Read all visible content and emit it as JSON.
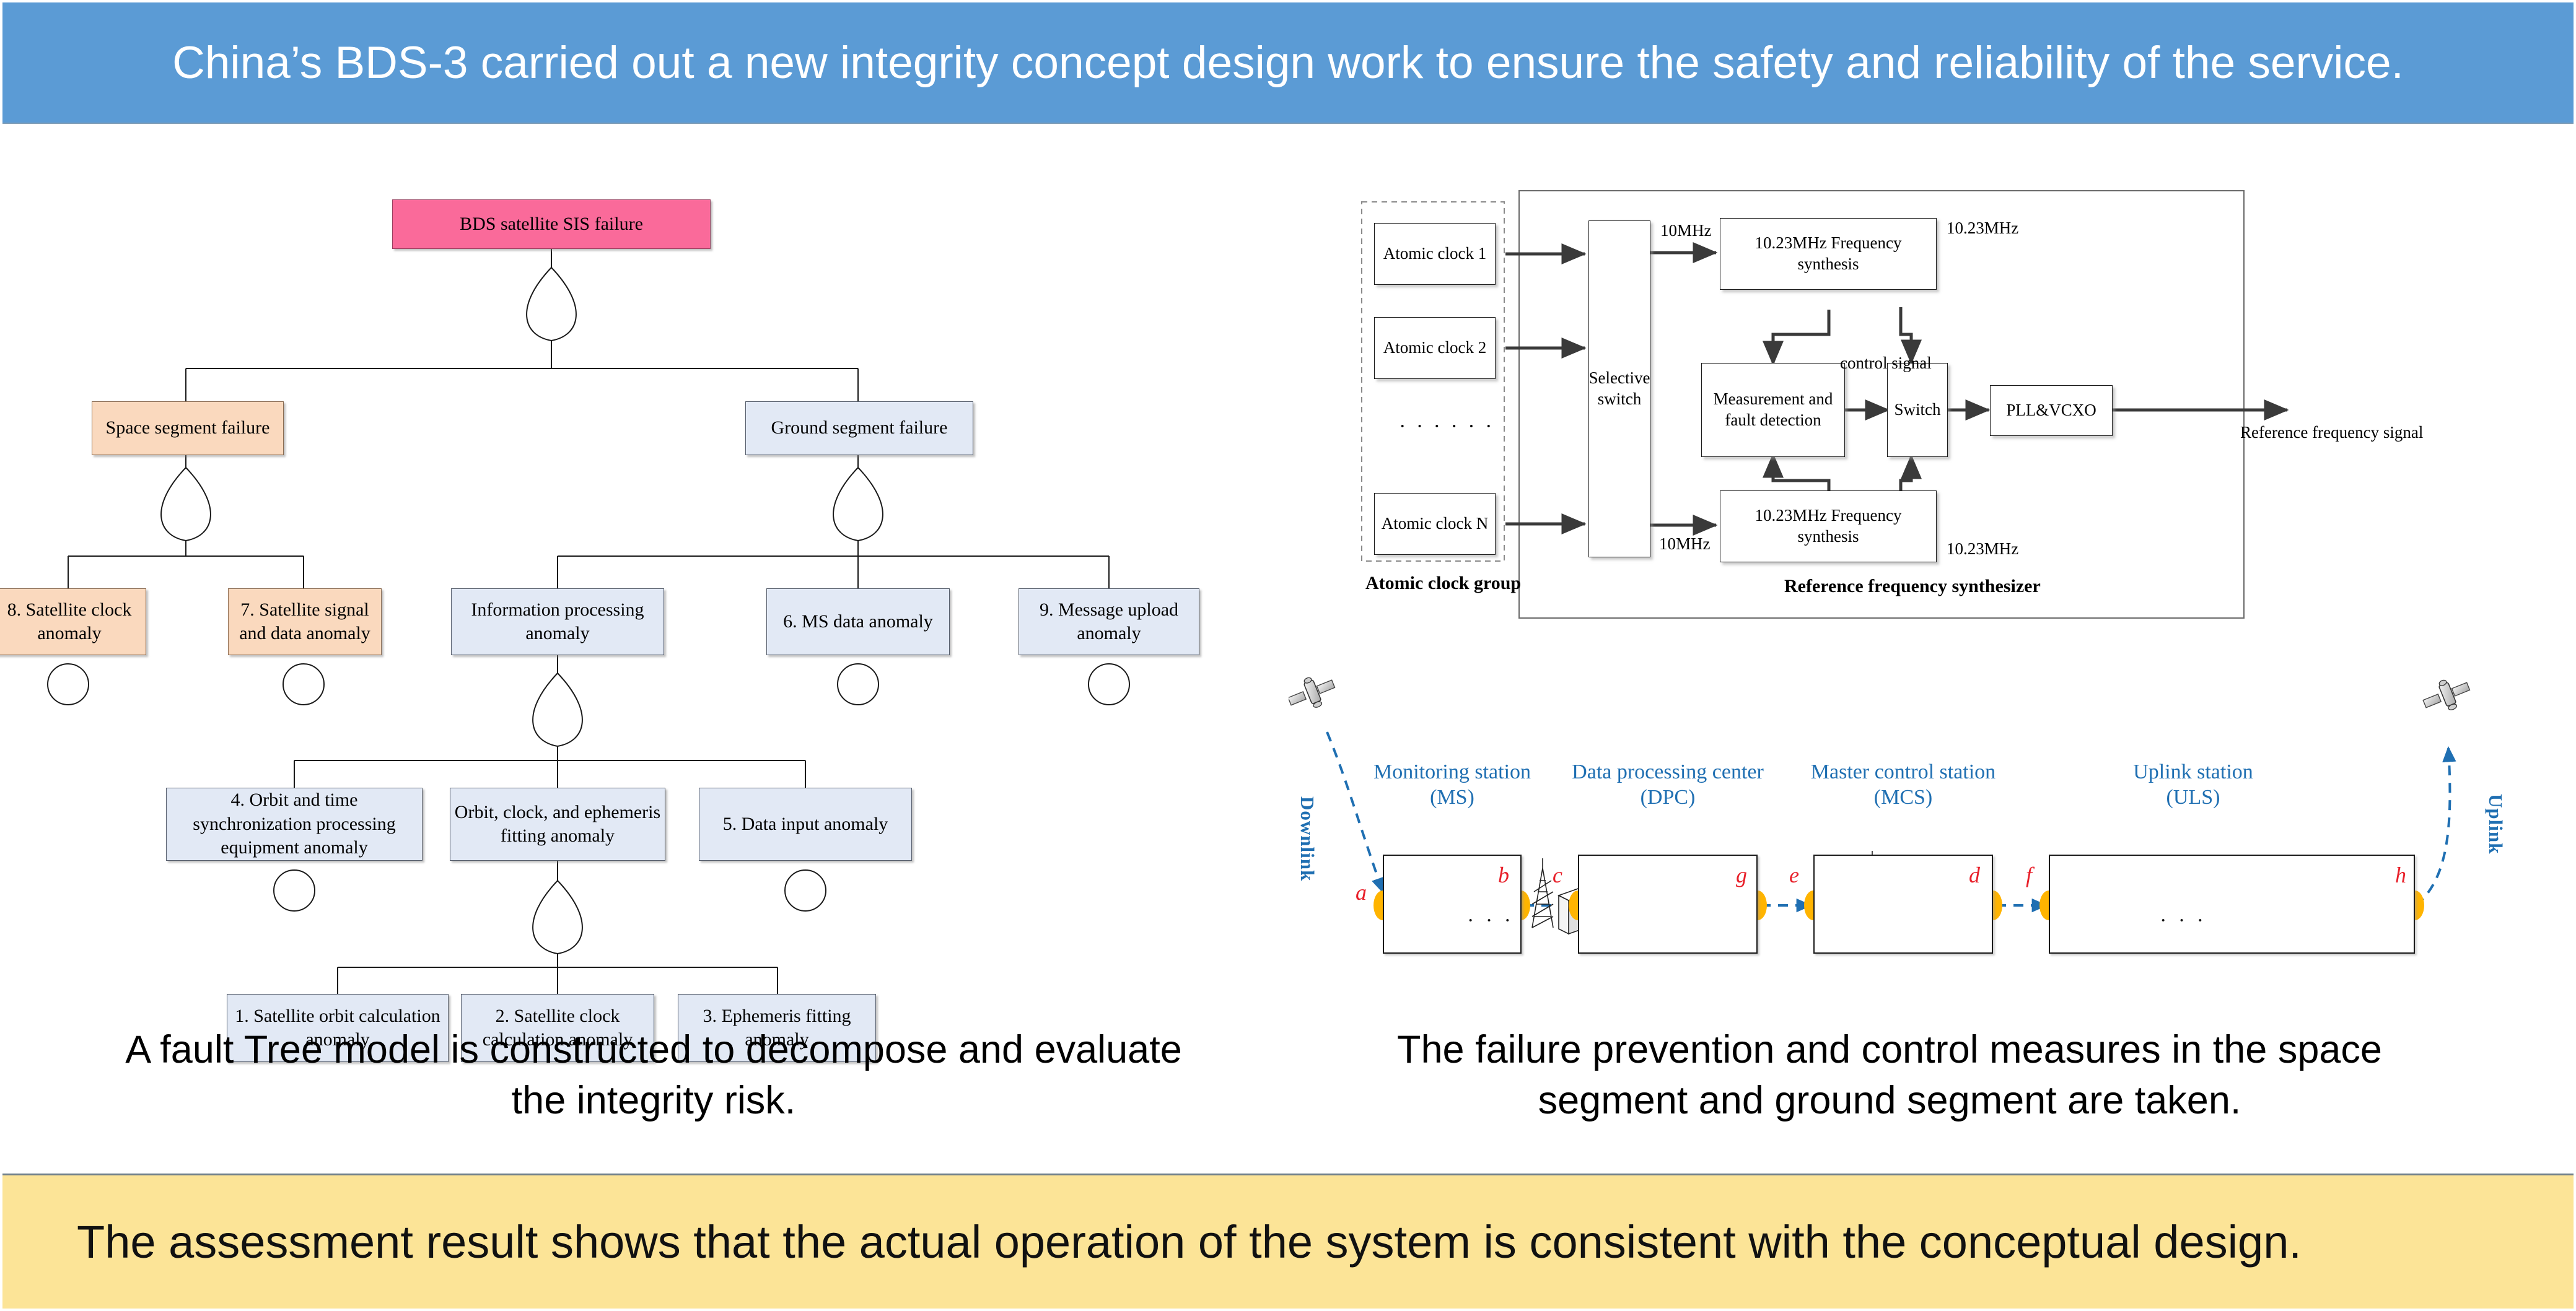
{
  "header": {
    "title": "China’s BDS-3 carried out a new integrity concept design work  to ensure the safety and reliability of the service."
  },
  "footer": {
    "text": "The assessment result shows that the actual operation of the system is consistent with the conceptual design."
  },
  "captions": {
    "left": "A fault Tree model is constructed to decompose and evaluate the integrity risk.",
    "right": "The failure prevention and control measures in the space segment and ground segment are taken."
  },
  "fault_tree": {
    "nodes": {
      "top": "BDS satellite SIS failure",
      "space_segment": "Space segment failure",
      "ground_segment": "Ground segment failure",
      "sat_clock": "8. Satellite clock anomaly",
      "sat_signal": "7. Satellite signal and data anomaly",
      "info_processing": "Information processing anomaly",
      "ms_data": "6. MS data anomaly",
      "msg_upload": "9. Message upload anomaly",
      "orbit_time_sync": "4. Orbit and time synchronization processing equipment anomaly",
      "orbit_clock_eph": "Orbit, clock, and ephemeris fitting anomaly",
      "data_input": "5. Data input anomaly",
      "sat_orbit_calc": "1. Satellite orbit calculation anomaly",
      "sat_clock_calc": "2. Satellite clock calculation anomaly",
      "eph_fitting": "3. Ephemeris fitting anomaly"
    },
    "colors": {
      "top_fill": "#FA6A9A",
      "space_fill": "#FAD9BE",
      "ground_fill": "#E2E9F5"
    }
  },
  "freq_diagram": {
    "group_label": "Atomic clock group",
    "synth_label": "Reference frequency synthesizer",
    "clocks": [
      "Atomic clock 1",
      "Atomic clock 2",
      "Atomic clock N"
    ],
    "clock_ellipsis": "· · · · · ·",
    "selective_switch": "Selective switch",
    "synth_top": "10.23MHz Frequency synthesis",
    "synth_bottom": "10.23MHz Frequency synthesis",
    "measurement": "Measurement and fault detection",
    "switch": "Switch",
    "pll": "PLL&VCXO",
    "labels": {
      "in_top": "10MHz",
      "in_bottom": "10MHz",
      "out_top": "10.23MHz",
      "out_bottom": "10.23MHz",
      "control": "control signal",
      "reference_out": "Reference frequency signal"
    }
  },
  "ground_diagram": {
    "downlink": "Downlink",
    "uplink": "Uplink",
    "stations": [
      {
        "name": "Monitoring station",
        "abbr": "(MS)"
      },
      {
        "name": "Data processing center",
        "abbr": "(DPC)"
      },
      {
        "name": "Master control station",
        "abbr": "(MCS)"
      },
      {
        "name": "Uplink station",
        "abbr": "(ULS)"
      }
    ],
    "node_letters": [
      "a",
      "b",
      "c",
      "d",
      "e",
      "f",
      "g",
      "h"
    ],
    "ellipsis": "· · ·",
    "colors": {
      "title": "#1F6FB2",
      "node": "#FFB400",
      "letter": "#E8202A"
    }
  }
}
